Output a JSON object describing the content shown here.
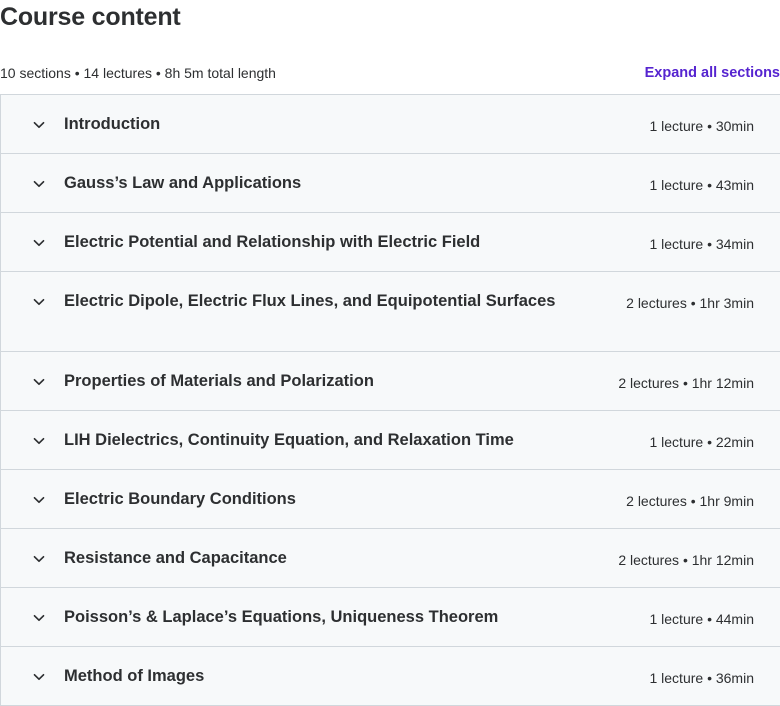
{
  "header": {
    "title": "Course content"
  },
  "summary": {
    "text": "10 sections • 14 lectures • 8h 5m total length",
    "expand_label": "Expand all sections"
  },
  "sections": [
    {
      "title": "Introduction",
      "meta": "1 lecture • 30min"
    },
    {
      "title": "Gauss’s Law and Applications",
      "meta": "1 lecture • 43min"
    },
    {
      "title": "Electric Potential and Relationship with Electric Field",
      "meta": "1 lecture • 34min"
    },
    {
      "title": "Electric Dipole, Electric Flux Lines, and Equipotential Surfaces",
      "meta": "2 lectures • 1hr 3min"
    },
    {
      "title": "Properties of Materials and Polarization",
      "meta": "2 lectures • 1hr 12min"
    },
    {
      "title": "LIH Dielectrics, Continuity Equation, and Relaxation Time",
      "meta": "1 lecture • 22min"
    },
    {
      "title": "Electric Boundary Conditions",
      "meta": "2 lectures • 1hr 9min"
    },
    {
      "title": "Resistance and Capacitance",
      "meta": "2 lectures • 1hr 12min"
    },
    {
      "title": "Poisson’s & Laplace’s Equations, Uniqueness Theorem",
      "meta": "1 lecture • 44min"
    },
    {
      "title": "Method of Images",
      "meta": "1 lecture • 36min"
    }
  ],
  "icons": {
    "section_toggle": "chevron-down-icon"
  },
  "colors": {
    "text": "#2d2f31",
    "accent": "#5624d0",
    "row_background": "#f7f9fa",
    "border": "#d1d7dc"
  }
}
